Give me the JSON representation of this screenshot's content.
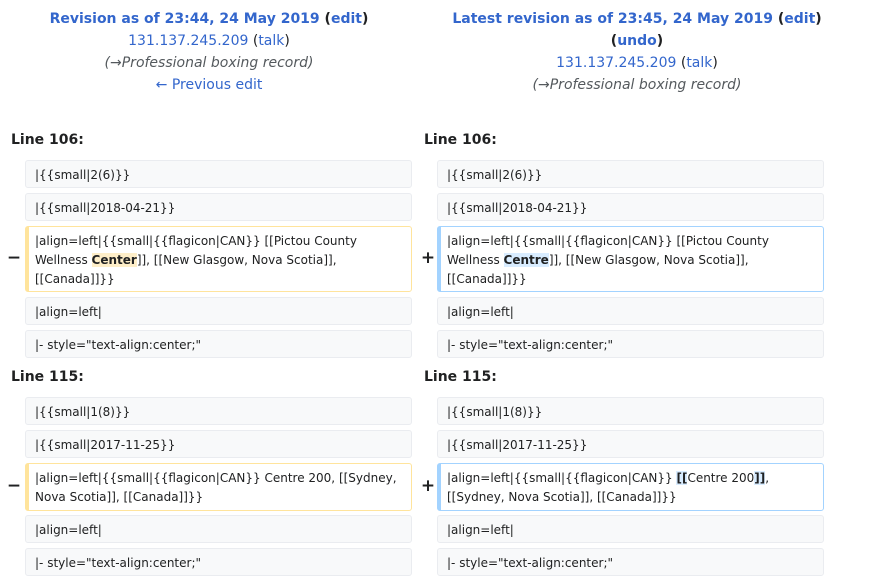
{
  "left_header": {
    "title_prefix": "Revision as of 23:44, 24 May 2019",
    "edit_label": "edit",
    "user": "131.137.245.209",
    "talk_label": "talk",
    "summary": "(→Professional boxing record)",
    "prev_edit_label": "← Previous edit"
  },
  "right_header": {
    "title_prefix": "Latest revision as of 23:45, 24 May 2019",
    "edit_label": "edit",
    "undo_label": "undo",
    "user": "131.137.245.209",
    "talk_label": "talk",
    "summary": "(→Professional boxing record)"
  },
  "hunks": [
    {
      "left_line": "Line 106:",
      "right_line": "Line 106:",
      "context_before": [
        "|{{small|2(6)}}",
        "|{{small|2018-04-21}}"
      ],
      "deleted": {
        "before": "|align=left|{{small|{{flagicon|CAN}} [[Pictou County Wellness ",
        "change": "Center",
        "after": "]], [[New Glasgow, Nova Scotia]], [[Canada]]}}"
      },
      "added": {
        "before": "|align=left|{{small|{{flagicon|CAN}} [[Pictou County Wellness ",
        "change": "Centre",
        "after": "]], [[New Glasgow, Nova Scotia]], [[Canada]]}}"
      },
      "context_after": [
        "|align=left|",
        "|- style=\"text-align:center;\""
      ]
    },
    {
      "left_line": "Line 115:",
      "right_line": "Line 115:",
      "context_before": [
        "|{{small|1(8)}}",
        "|{{small|2017-11-25}}"
      ],
      "deleted": {
        "text": "|align=left|{{small|{{flagicon|CAN}} Centre 200, [[Sydney, Nova Scotia]], [[Canada]]}}"
      },
      "added": {
        "before": "|align=left|{{small|{{flagicon|CAN}} ",
        "open": "[[",
        "middle": "Centre 200",
        "close": "]]",
        "after": ", [[Sydney, Nova Scotia]], [[Canada]]}}"
      },
      "context_after": [
        "|align=left|",
        "|- style=\"text-align:center;\""
      ]
    }
  ],
  "markers": {
    "minus": "−",
    "plus": "+"
  }
}
